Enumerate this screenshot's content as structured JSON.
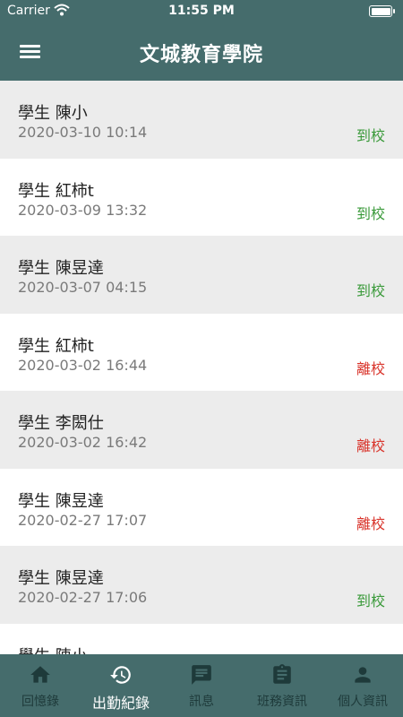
{
  "status_bar": {
    "carrier": "Carrier",
    "time": "11:55 PM"
  },
  "app_bar": {
    "title": "文城教育學院"
  },
  "colors": {
    "primary": "#456c6c",
    "arrive": "#3a9a3a",
    "leave": "#d9342b"
  },
  "records": [
    {
      "name": "學生 陳小",
      "timestamp": "2020-03-10 10:14",
      "status": "到校",
      "type": "arrive"
    },
    {
      "name": "學生 紅柿t",
      "timestamp": "2020-03-09 13:32",
      "status": "到校",
      "type": "arrive"
    },
    {
      "name": "學生 陳昱達",
      "timestamp": "2020-03-07 04:15",
      "status": "到校",
      "type": "arrive"
    },
    {
      "name": "學生 紅柿t",
      "timestamp": "2020-03-02 16:44",
      "status": "離校",
      "type": "leave"
    },
    {
      "name": "學生 李閎仕",
      "timestamp": "2020-03-02 16:42",
      "status": "離校",
      "type": "leave"
    },
    {
      "name": "學生 陳昱達",
      "timestamp": "2020-02-27 17:07",
      "status": "離校",
      "type": "leave"
    },
    {
      "name": "學生 陳昱達",
      "timestamp": "2020-02-27 17:06",
      "status": "到校",
      "type": "arrive"
    },
    {
      "name": "學生 陳小",
      "timestamp": "",
      "status": "",
      "type": "arrive"
    }
  ],
  "tabs": [
    {
      "label": "回憶錄",
      "icon": "home-icon",
      "active": false
    },
    {
      "label": "出勤紀錄",
      "icon": "history-icon",
      "active": true
    },
    {
      "label": "訊息",
      "icon": "message-icon",
      "active": false
    },
    {
      "label": "班務資訊",
      "icon": "clipboard-icon",
      "active": false
    },
    {
      "label": "個人資訊",
      "icon": "person-icon",
      "active": false
    }
  ]
}
